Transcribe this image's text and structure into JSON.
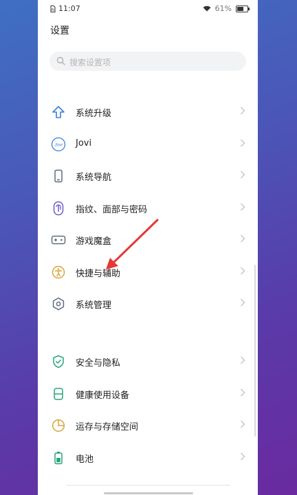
{
  "status_bar": {
    "time": "11:07",
    "battery": "61%"
  },
  "header": {
    "title": "设置"
  },
  "search": {
    "placeholder": "搜索设置项"
  },
  "group1": [
    {
      "label": "系统升级",
      "icon": "up-arrow-icon"
    },
    {
      "label": "Jovi",
      "icon": "jovi-icon",
      "icon_text": "Jovi"
    },
    {
      "label": "系统导航",
      "icon": "phone-icon"
    },
    {
      "label": "指纹、面部与密码",
      "icon": "fingerprint-icon"
    },
    {
      "label": "游戏魔盒",
      "icon": "gamepad-icon"
    },
    {
      "label": "快捷与辅助",
      "icon": "accessibility-icon"
    },
    {
      "label": "系统管理",
      "icon": "hexagon-gear-icon"
    }
  ],
  "group2": [
    {
      "label": "安全与隐私",
      "icon": "shield-check-icon"
    },
    {
      "label": "健康使用设备",
      "icon": "hourglass-icon"
    },
    {
      "label": "运存与存储空间",
      "icon": "pie-storage-icon"
    },
    {
      "label": "电池",
      "icon": "battery-icon"
    }
  ],
  "colors": {
    "blue": "#3d7fd6",
    "purple": "#6a5bc8",
    "gold": "#d9a23b",
    "gray": "#5c6b80",
    "green": "#27a37a",
    "annotation_red": "#e53935"
  }
}
